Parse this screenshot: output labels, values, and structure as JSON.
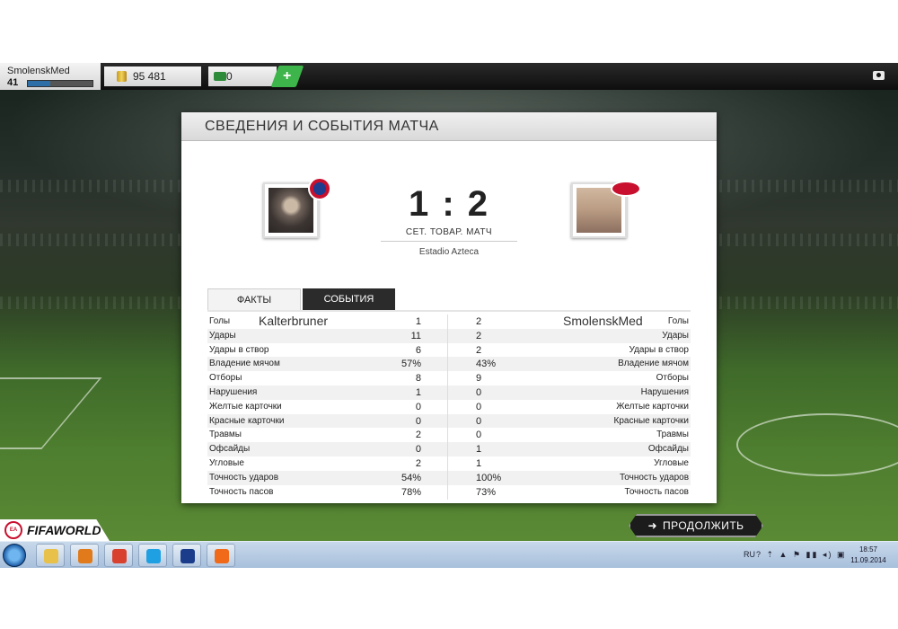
{
  "topbar": {
    "username": "SmolenskMed",
    "level": "41",
    "xp_fraction": 0.35,
    "coins": "95 481",
    "points": "0",
    "add_label": "+"
  },
  "panel": {
    "title": "СВЕДЕНИЯ И СОБЫТИЯ МАТЧА",
    "home_team": "Kalterbruner",
    "away_team": "SmolenskMed",
    "score": "1 : 2",
    "match_type": "СЕТ. ТОВАР. МАТЧ",
    "venue": "Estadio Azteca",
    "tabs": [
      {
        "label": "ФАКТЫ",
        "active": true
      },
      {
        "label": "СОБЫТИЯ",
        "active": false
      }
    ],
    "stats": [
      {
        "label": "Голы",
        "home": "1",
        "away": "2"
      },
      {
        "label": "Удары",
        "home": "11",
        "away": "2"
      },
      {
        "label": "Удары в створ",
        "home": "6",
        "away": "2"
      },
      {
        "label": "Владение мячом",
        "home": "57%",
        "away": "43%"
      },
      {
        "label": "Отборы",
        "home": "8",
        "away": "9"
      },
      {
        "label": "Нарушения",
        "home": "1",
        "away": "0"
      },
      {
        "label": "Желтые карточки",
        "home": "0",
        "away": "0"
      },
      {
        "label": "Красные карточки",
        "home": "0",
        "away": "0"
      },
      {
        "label": "Травмы",
        "home": "2",
        "away": "0"
      },
      {
        "label": "Офсайды",
        "home": "0",
        "away": "1"
      },
      {
        "label": "Угловые",
        "home": "2",
        "away": "1"
      },
      {
        "label": "Точность ударов",
        "home": "54%",
        "away": "100%"
      },
      {
        "label": "Точность пасов",
        "home": "78%",
        "away": "73%"
      }
    ]
  },
  "footer": {
    "logo_text": "FIFAWORLD",
    "ea_text": "EA SPORTS",
    "continue_label": "ПРОДОЛЖИТЬ",
    "continue_arrow": "➜"
  },
  "taskbar": {
    "language": "RU",
    "tray_icons": "? ⇡ ▲ ⚑ ▮▮ ◂) ▣",
    "time": "18:57",
    "date": "11.09.2014",
    "apps": [
      {
        "icon": "explorer-icon",
        "color": "#e8c14a"
      },
      {
        "icon": "media-player-icon",
        "color": "#e07a1a"
      },
      {
        "icon": "chrome-icon",
        "color": "#d9412f"
      },
      {
        "icon": "skype-icon",
        "color": "#1fa0e3"
      },
      {
        "icon": "fifa-world-icon",
        "color": "#1a3c8a"
      },
      {
        "icon": "origin-icon",
        "color": "#f06a1a"
      }
    ]
  }
}
